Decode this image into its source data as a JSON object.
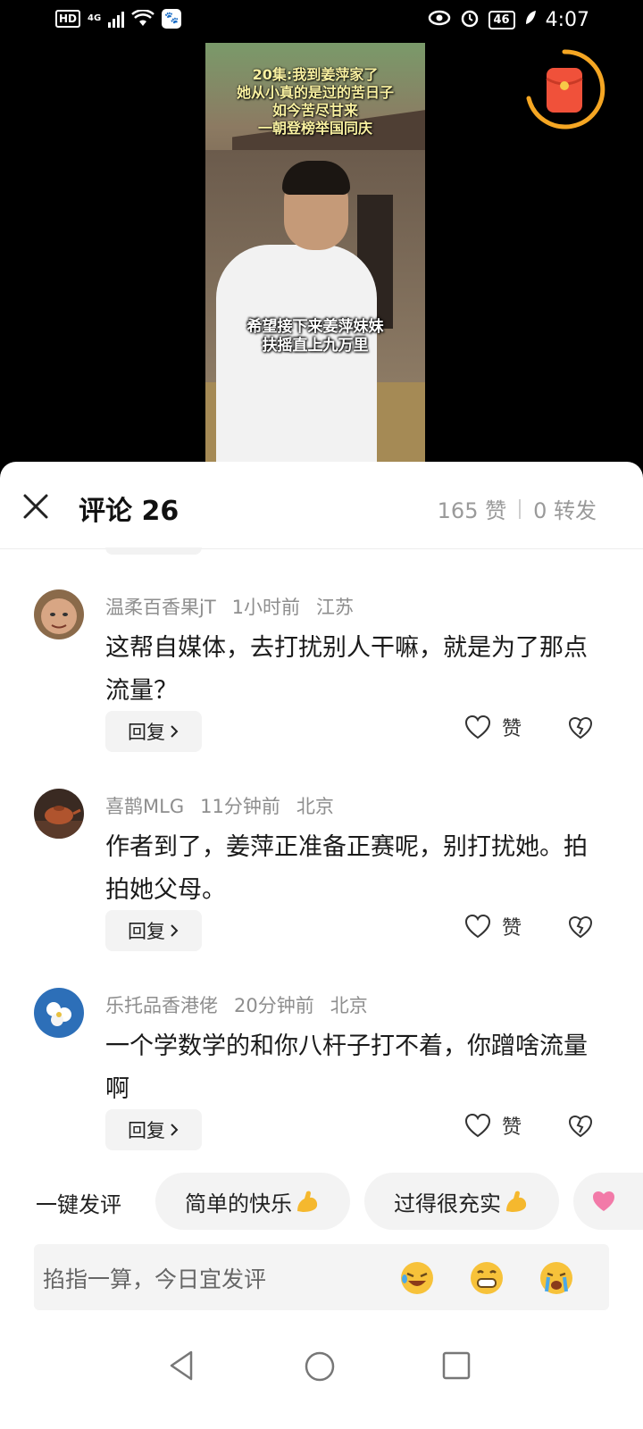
{
  "status_bar": {
    "hd": "HD",
    "network": "4G",
    "time": "4:07",
    "battery": "46"
  },
  "video": {
    "caption_top": [
      "20集:我到姜萍家了",
      "她从小真的是过的苦日子",
      "如今苦尽甘来",
      "一朝登榜举国同庆"
    ],
    "caption_bottom": [
      "希望接下来姜萍妹妹",
      "扶摇直上九万里"
    ]
  },
  "sheet": {
    "title": "评论 26",
    "likes": "165 赞",
    "shares": "0 转发"
  },
  "comments": [
    {
      "user": "温柔百香果jT",
      "time": "1小时前",
      "location": "江苏",
      "text": "这帮自媒体，去打扰别人干嘛，就是为了那点流量？",
      "reply_label": "回复",
      "like_label": "赞"
    },
    {
      "user": "喜鹊MLG",
      "time": "11分钟前",
      "location": "北京",
      "text": "作者到了，姜萍正准备正赛呢，别打扰她。拍拍她父母。",
      "reply_label": "回复",
      "like_label": "赞"
    },
    {
      "user": "乐托品香港佬",
      "time": "20分钟前",
      "location": "北京",
      "text": "一个学数学的和你八杆子打不着，你蹭啥流量啊",
      "reply_label": "回复",
      "like_label": "赞"
    }
  ],
  "quick_comment": {
    "label": "一键发评",
    "chips": [
      "简单的快乐",
      "过得很充实"
    ]
  },
  "input": {
    "placeholder": "掐指一算，今日宜发评"
  },
  "icons": {
    "close": "close-icon",
    "like": "heart-outline-icon",
    "dislike": "broken-heart-icon",
    "red_packet": "red-packet-icon"
  },
  "colors": {
    "accent_ring": "#f5a623",
    "red_packet": "#f0513a",
    "chip_bg": "#f3f3f3"
  }
}
